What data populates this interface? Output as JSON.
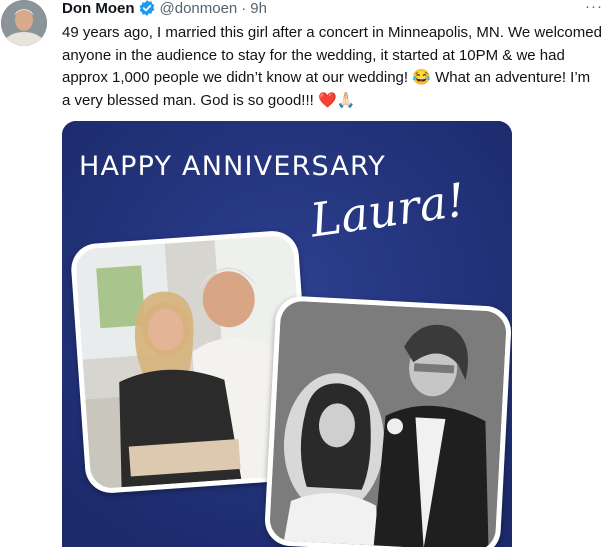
{
  "author": {
    "name": "Don Moen",
    "handle": "@donmoen",
    "separator": "·",
    "time": "9h",
    "avatar_icon": "avatar-photo-icon",
    "verified_icon": "verified-badge-icon",
    "verified_color": "#1d9bf0"
  },
  "more_label": "···",
  "tweet": {
    "text": "49 years ago, I married this girl after a concert in Minneapolis, MN. We welcomed anyone in the audience to stay for the wedding, it started at 10PM & we had approx 1,000 people we didn’t know at our wedding! 😂 What an adventure! I’m a very blessed man. God is so good!!! ❤️🙏🏻"
  },
  "media": {
    "headline": "HAPPY ANNIVERSARY",
    "name": "Laura!",
    "background_color": "#23347a"
  }
}
